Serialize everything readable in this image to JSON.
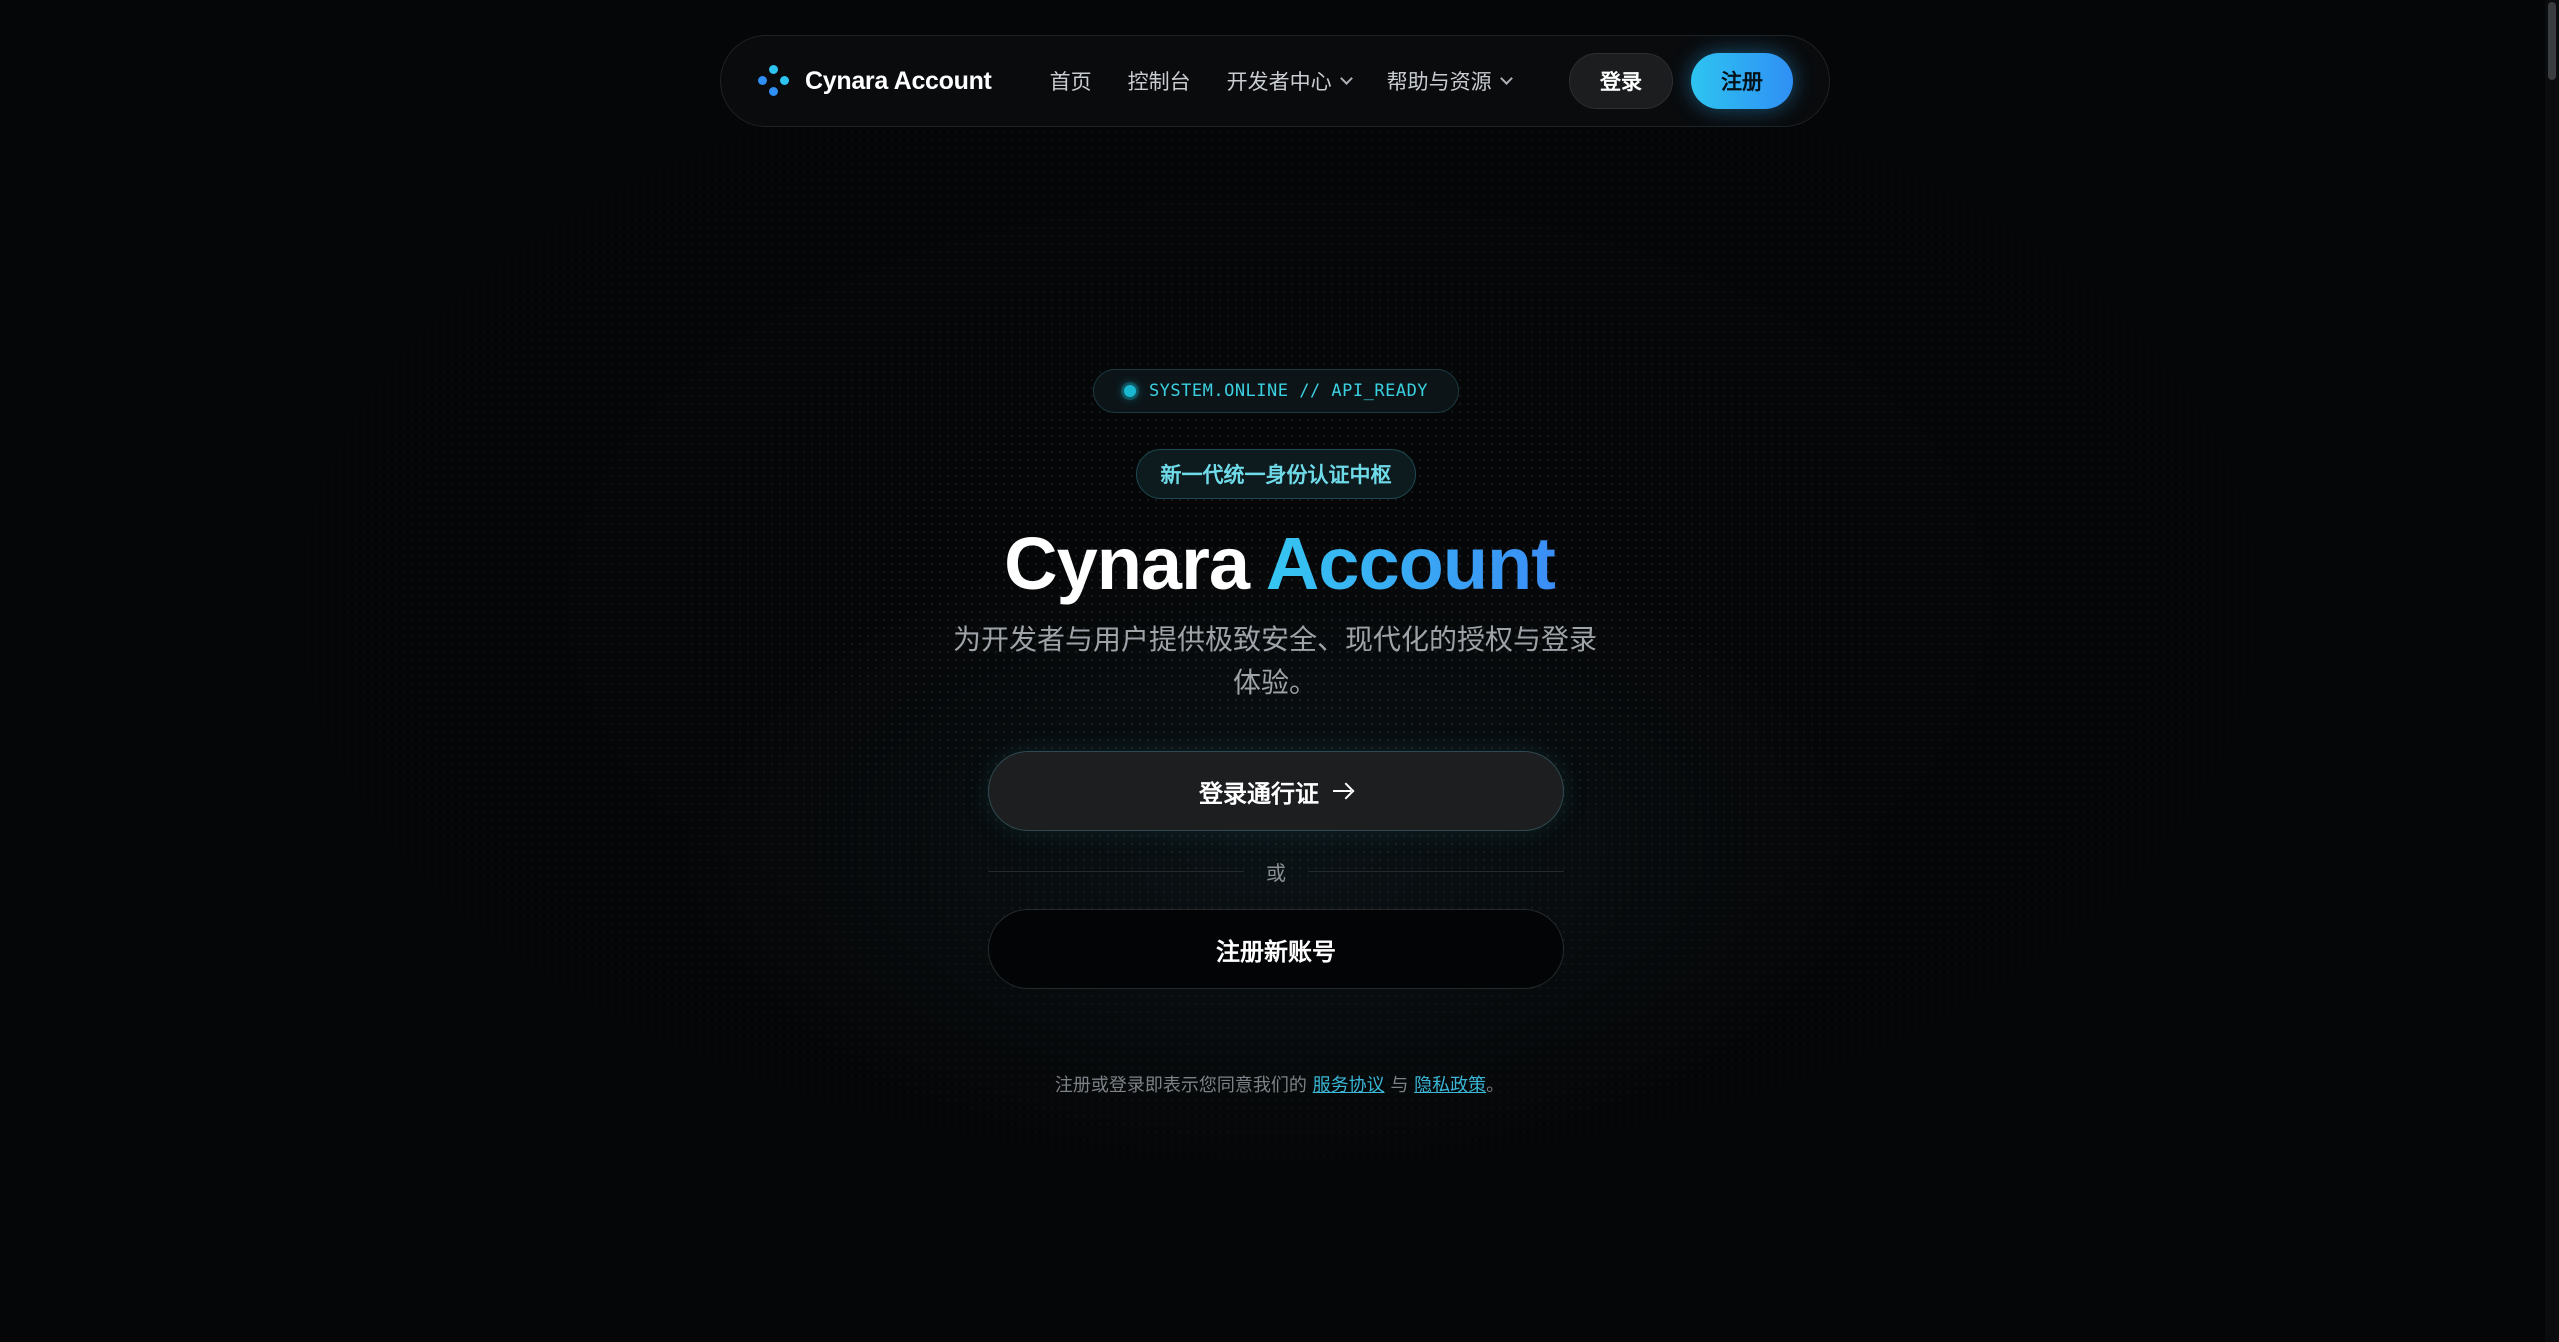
{
  "nav": {
    "brand": "Cynara Account",
    "links": [
      {
        "label": "首页"
      },
      {
        "label": "控制台"
      },
      {
        "label": "开发者中心"
      },
      {
        "label": "帮助与资源"
      }
    ],
    "login_label": "登录",
    "register_label": "注册"
  },
  "hero": {
    "status": "SYSTEM.ONLINE // API_READY",
    "tag": "新一代统一身份认证中枢",
    "title_main": "Cynara",
    "title_accent": "Account",
    "subtitle": "为开发者与用户提供极致安全、现代化的授权与登录体验。",
    "primary_button": "登录通行证",
    "divider": "或",
    "secondary_button": "注册新账号"
  },
  "terms": {
    "prefix": "注册或登录即表示您同意我们的",
    "service_link": "服务协议",
    "joiner": "与",
    "privacy_link": "隐私政策",
    "suffix": "。"
  },
  "colors": {
    "accent": "#2ec4f0",
    "accent_end": "#2f8ff5",
    "background": "#050607",
    "status_text": "#3bd0e0"
  }
}
